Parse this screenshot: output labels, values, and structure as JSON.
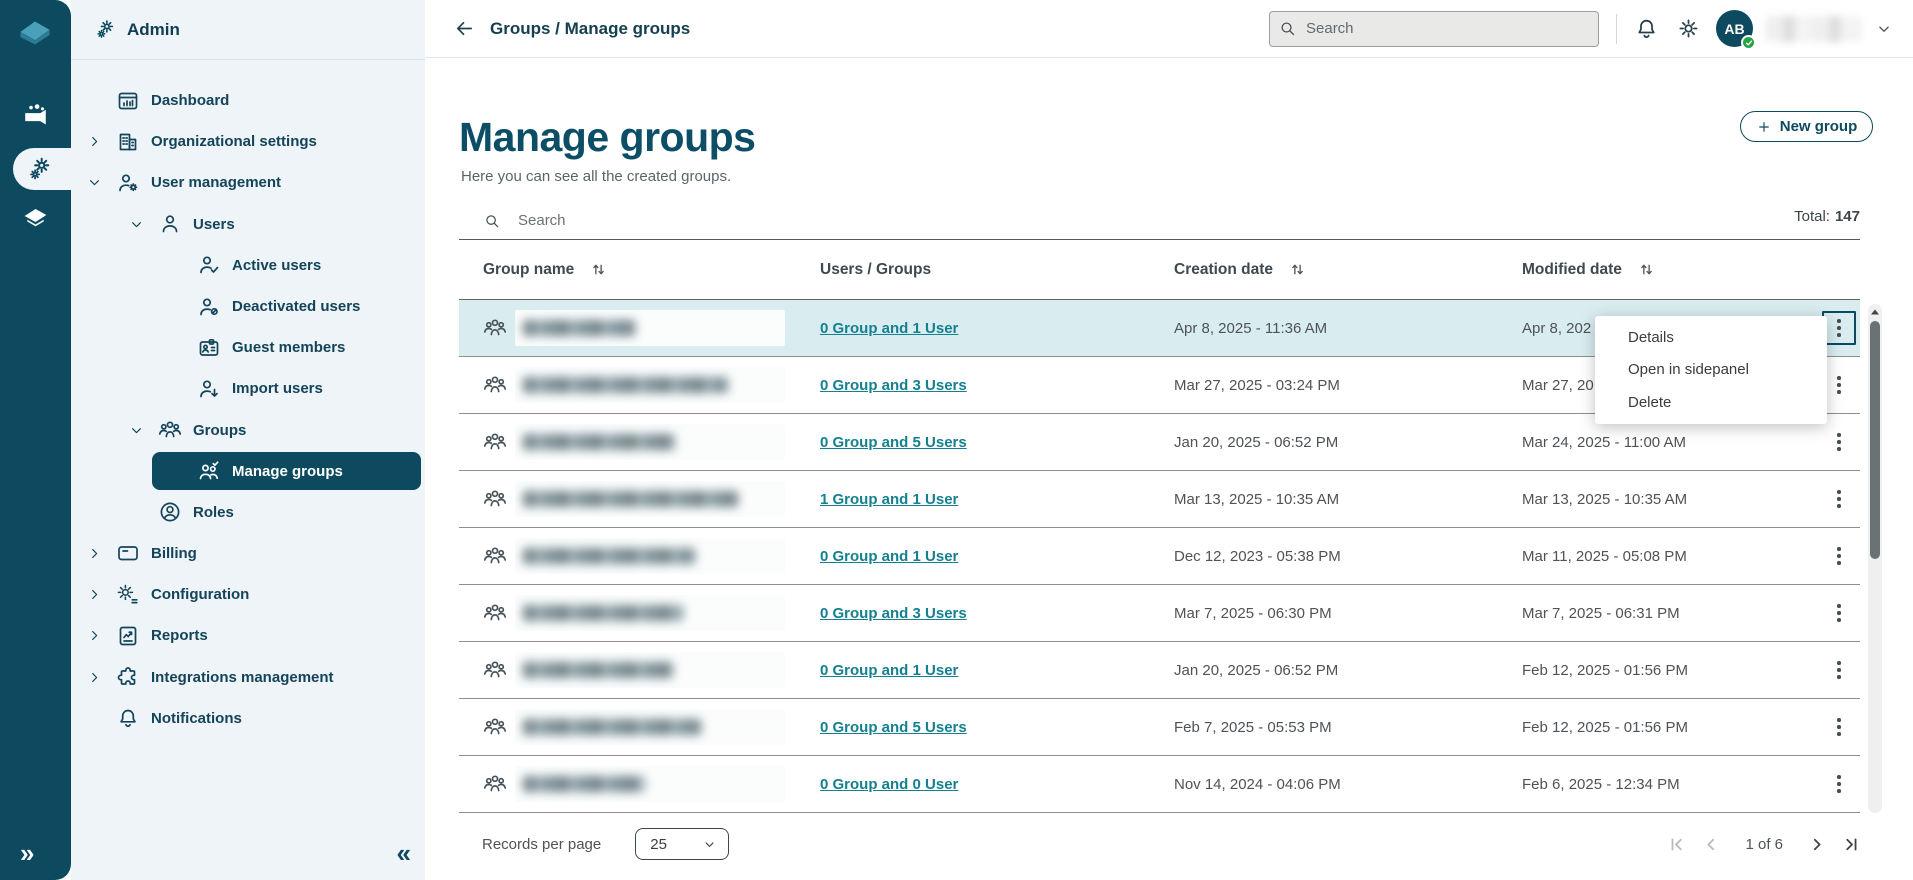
{
  "topbar": {
    "breadcrumb": "Groups / Manage groups",
    "search_placeholder": "Search",
    "avatar_initials": "AB"
  },
  "sidebar": {
    "header_label": "Admin",
    "items": [
      {
        "label": "Dashboard",
        "icon": "dashboard",
        "level": 0,
        "chevron": null,
        "selected": false
      },
      {
        "label": "Organizational settings",
        "icon": "building",
        "level": 0,
        "chevron": "right",
        "selected": false
      },
      {
        "label": "User management",
        "icon": "user-gear",
        "level": 0,
        "chevron": "down",
        "selected": false
      },
      {
        "label": "Users",
        "icon": "user",
        "level": 1,
        "chevron": "down",
        "selected": false
      },
      {
        "label": "Active users",
        "icon": "user-check",
        "level": 2,
        "chevron": null,
        "selected": false
      },
      {
        "label": "Deactivated users",
        "icon": "user-slash",
        "level": 2,
        "chevron": null,
        "selected": false
      },
      {
        "label": "Guest members",
        "icon": "id-card",
        "level": 2,
        "chevron": null,
        "selected": false
      },
      {
        "label": "Import users",
        "icon": "user-down",
        "level": 2,
        "chevron": null,
        "selected": false
      },
      {
        "label": "Groups",
        "icon": "users",
        "level": 1,
        "chevron": "down",
        "selected": false
      },
      {
        "label": "Manage groups",
        "icon": "users-check",
        "level": 2,
        "chevron": null,
        "selected": true
      },
      {
        "label": "Roles",
        "icon": "user-circle",
        "level": 1,
        "chevron": null,
        "selected": false
      },
      {
        "label": "Billing",
        "icon": "credit-card",
        "level": 0,
        "chevron": "right",
        "selected": false
      },
      {
        "label": "Configuration",
        "icon": "gear-sliders",
        "level": 0,
        "chevron": "right",
        "selected": false
      },
      {
        "label": "Reports",
        "icon": "report",
        "level": 0,
        "chevron": "right",
        "selected": false
      },
      {
        "label": "Integrations management",
        "icon": "puzzle",
        "level": 0,
        "chevron": "right",
        "selected": false
      },
      {
        "label": "Notifications",
        "icon": "bell",
        "level": 0,
        "chevron": null,
        "selected": false
      }
    ]
  },
  "page": {
    "title": "Manage groups",
    "subtitle": "Here you can see all the created groups.",
    "new_group_label": "New group",
    "search_placeholder": "Search",
    "total_label": "Total:",
    "total_value": "147"
  },
  "table": {
    "columns": [
      {
        "label": "Group name",
        "sortable": true
      },
      {
        "label": "Users / Groups",
        "sortable": false
      },
      {
        "label": "Creation date",
        "sortable": true
      },
      {
        "label": "Modified date",
        "sortable": true
      }
    ],
    "rows": [
      {
        "name_redacted": true,
        "users_groups": "0 Group and 1 User",
        "creation_date": "Apr 8, 2025 - 11:36 AM",
        "modified_date": "Apr 8, 202",
        "highlighted": true
      },
      {
        "name_redacted": true,
        "users_groups": "0 Group and 3 Users",
        "creation_date": "Mar 27, 2025 - 03:24 PM",
        "modified_date": "Mar 27, 20",
        "highlighted": false
      },
      {
        "name_redacted": true,
        "users_groups": "0 Group and 5 Users",
        "creation_date": "Jan 20, 2025 - 06:52 PM",
        "modified_date": "Mar 24, 2025 - 11:00 AM",
        "highlighted": false
      },
      {
        "name_redacted": true,
        "users_groups": "1 Group and 1 User",
        "creation_date": "Mar 13, 2025 - 10:35 AM",
        "modified_date": "Mar 13, 2025 - 10:35 AM",
        "highlighted": false
      },
      {
        "name_redacted": true,
        "users_groups": "0 Group and 1 User",
        "creation_date": "Dec 12, 2023 - 05:38 PM",
        "modified_date": "Mar 11, 2025 - 05:08 PM",
        "highlighted": false
      },
      {
        "name_redacted": true,
        "users_groups": "0 Group and 3 Users",
        "creation_date": "Mar 7, 2025 - 06:30 PM",
        "modified_date": "Mar 7, 2025 - 06:31 PM",
        "highlighted": false
      },
      {
        "name_redacted": true,
        "users_groups": "0 Group and 1 User",
        "creation_date": "Jan 20, 2025 - 06:52 PM",
        "modified_date": "Feb 12, 2025 - 01:56 PM",
        "highlighted": false
      },
      {
        "name_redacted": true,
        "users_groups": "0 Group and 5 Users",
        "creation_date": "Feb 7, 2025 - 05:53 PM",
        "modified_date": "Feb 12, 2025 - 01:56 PM",
        "highlighted": false
      },
      {
        "name_redacted": true,
        "users_groups": "0 Group and 0 User",
        "creation_date": "Nov 14, 2024 - 04:06 PM",
        "modified_date": "Feb 6, 2025 - 12:34 PM",
        "highlighted": false
      }
    ]
  },
  "context_menu": {
    "items": [
      "Details",
      "Open in sidepanel",
      "Delete"
    ]
  },
  "pagination": {
    "records_per_page_label": "Records per page",
    "records_per_page_value": "25",
    "page_indicator": "1 of 6"
  },
  "colors": {
    "brand_dark_teal": "#0d4a5f",
    "link_teal": "#15808f",
    "row_highlight": "#d9edf1",
    "sidebar_bg": "#eef4f7",
    "avatar_badge_green": "#27a347"
  }
}
